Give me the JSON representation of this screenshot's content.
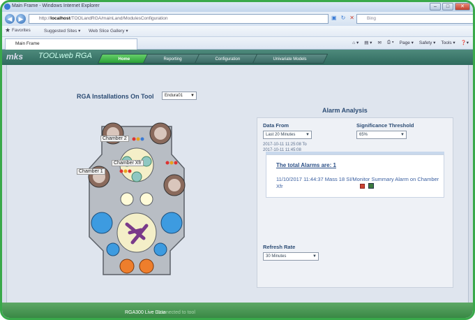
{
  "browser": {
    "window_title": "Main Frame - Windows Internet Explorer",
    "address_prefix": "http://",
    "address_host": "localhost",
    "address_path": "/TOOLandRGA/mainLand/ModulesConfiguration",
    "search_placeholder": "Bing",
    "favorites_label": "Favorites",
    "fav_suggested": "Suggested Sites ▾",
    "fav_gallery": "Web Slice Gallery ▾",
    "tab_title": "Main Frame",
    "cmd_page": "Page ▾",
    "cmd_safety": "Safety ▾",
    "cmd_tools": "Tools ▾"
  },
  "app": {
    "logo_brand": "mks",
    "logo_product": "TOOLweb RGA",
    "nav_tabs": [
      {
        "label": "Home",
        "active": true
      },
      {
        "label": "Reporting",
        "active": false
      },
      {
        "label": "Configuration",
        "active": false
      },
      {
        "label": "Univariate Models",
        "active": false
      }
    ],
    "installations": {
      "title": "RGA Installations On Tool",
      "tool_value": "Endura01"
    },
    "chambers": {
      "chamber2": "Chamber 2",
      "chamber_xfr": "Chamber Xfr",
      "chamber1": "Chamber 1"
    },
    "alarm": {
      "title": "Alarm Analysis",
      "data_from_label": "Data From",
      "data_from_value": "Last 20 Minutes",
      "threshold_label": "Significance Threshold",
      "threshold_value": "65%",
      "range_from": "2017-10-11 11:25:08 To",
      "range_to": "2017-10-11 11:45:08",
      "total_alarms": "The total Alarms are:  1",
      "alarm_text": "11/10/2017 11:44:37 Mass 18 SI/Monitor Summary Alarm  on Chamber Xfr",
      "refresh_label": "Refresh Rate",
      "refresh_value": "30 Minutes"
    },
    "footer": {
      "status": "RGA300 Live Data",
      "status_faint": "Connected to tool"
    }
  }
}
